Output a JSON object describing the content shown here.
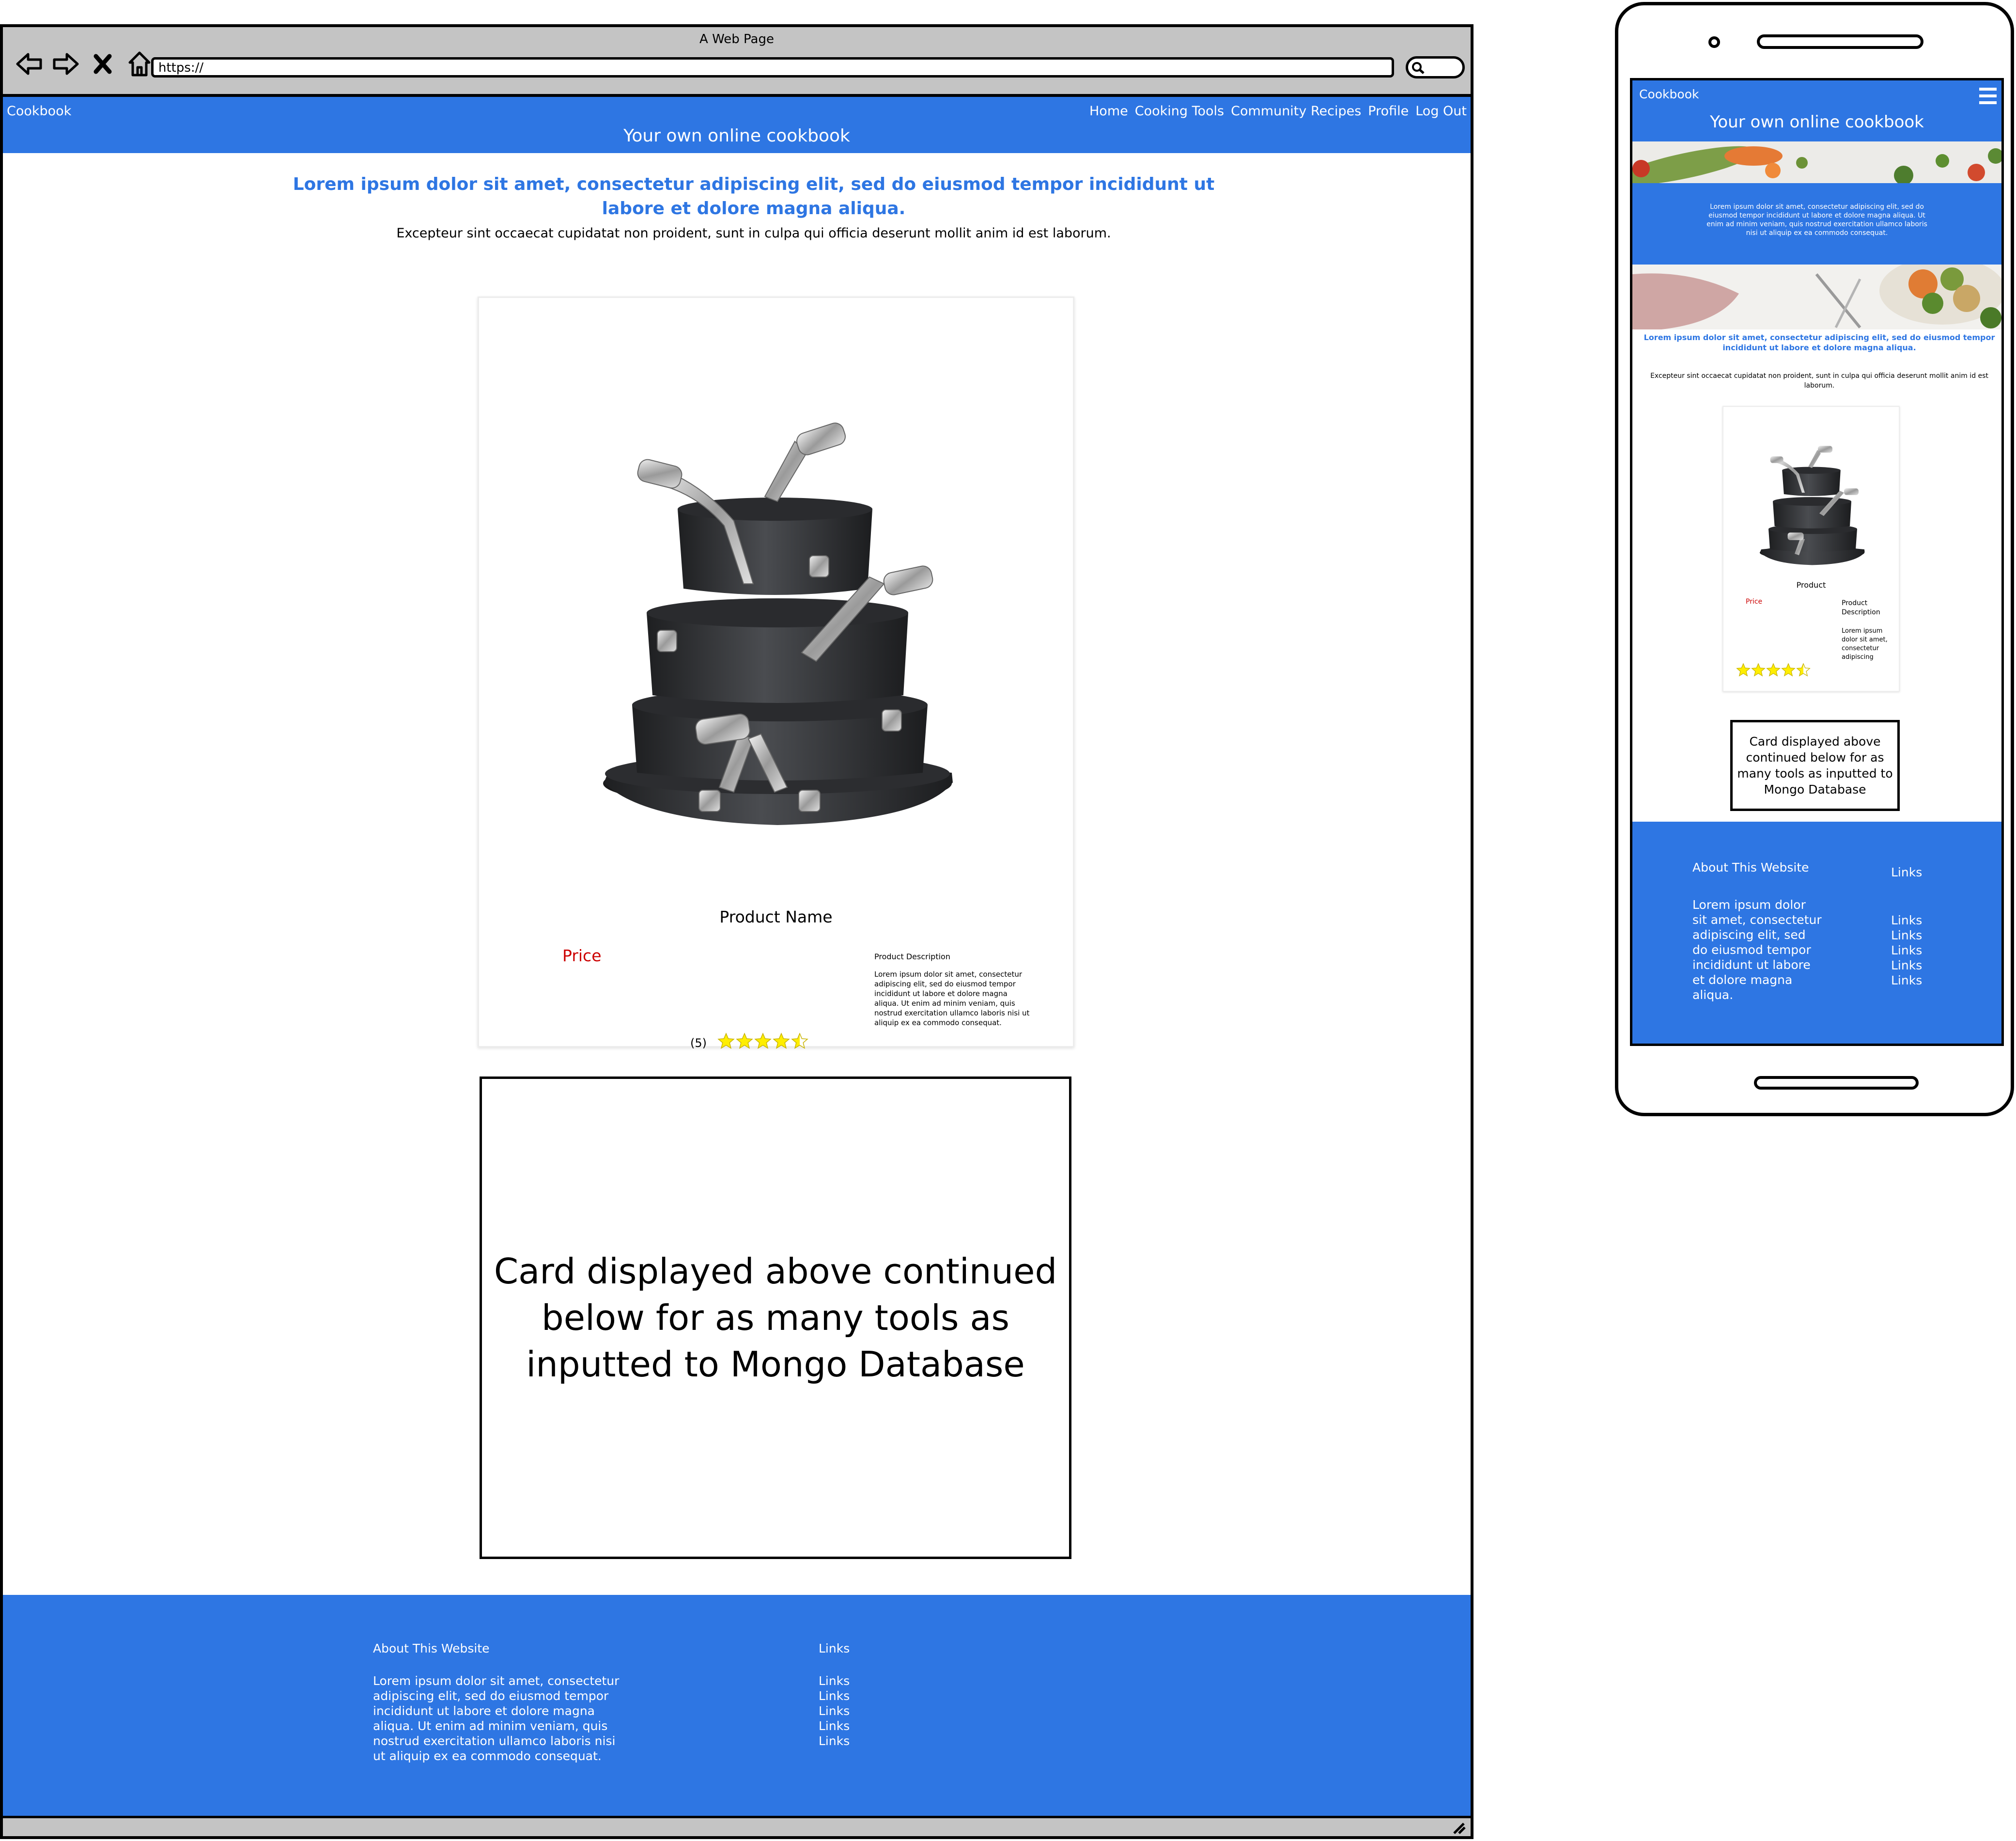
{
  "browser": {
    "window_title": "A Web Page",
    "address": "https://",
    "icons": [
      "back-arrow-icon",
      "forward-arrow-icon",
      "close-x-icon",
      "home-icon",
      "search-icon",
      "resize-grip-icon"
    ]
  },
  "site": {
    "brand": "Cookbook",
    "menu": [
      "Home",
      "Cooking Tools",
      "Community Recipes",
      "Profile",
      "Log Out"
    ],
    "hero_title": "Your own online cookbook",
    "accent_color": "#2e76e3",
    "price_color": "#cc0000",
    "star_color": "#ffee00"
  },
  "intro": {
    "lead": "Lorem ipsum dolor sit amet, consectetur adipiscing elit, sed do eiusmod tempor incididunt ut labore et dolore magna aliqua.",
    "sub": "Excepteur sint occaecat cupidatat non proident, sunt in culpa qui officia deserunt mollit anim id est laborum."
  },
  "card": {
    "image": "stacked-cookware-pots-image",
    "product_name": "Product Name",
    "price": "Price",
    "description_title": "Product Description",
    "description_text": "Lorem ipsum dolor sit amet, consectetur adipiscing elit, sed do eiusmod tempor incididunt ut labore et dolore magna aliqua. Ut enim ad minim veniam, quis nostrud exercitation ullamco laboris nisi ut aliquip ex ea commodo consequat.",
    "rating_count": "(5)",
    "rating": 4.5,
    "rating_max": 5
  },
  "note": {
    "text": "Card displayed above continued below for as many tools as inputted to Mongo Database"
  },
  "footer": {
    "about_heading": "About This Website",
    "about_text": "Lorem ipsum dolor sit amet, consectetur adipiscing elit, sed do eiusmod tempor incididunt ut labore et dolore magna aliqua. Ut enim ad minim veniam, quis nostrud exercitation ullamco laboris nisi ut aliquip ex ea commodo consequat.",
    "links_heading": "Links",
    "links": [
      "Links",
      "Links",
      "Links",
      "Links",
      "Links"
    ]
  },
  "mobile": {
    "brand": "Cookbook",
    "menu_icon": "hamburger-menu-icon",
    "hero_title": "Your own online cookbook",
    "banner_text": "Lorem ipsum dolor sit amet, consectetur adipiscing elit, sed do eiusmod tempor incididunt ut labore et dolore magna aliqua. Ut enim ad minim veniam, quis nostrud exercitation ullamco laboris nisi ut aliquip ex ea commodo consequat.",
    "lead": "Lorem ipsum dolor sit amet, consectetur adipiscing elit, sed do eiusmod tempor incididunt ut labore et dolore magna aliqua.",
    "sub": "Excepteur sint occaecat cupidatat non proident, sunt in culpa qui officia deserunt mollit anim id est laborum.",
    "product_name": "Product",
    "price": "Price",
    "description_title": "Product Description",
    "description_text": "Lorem ipsum dolor sit amet, consectetur adipiscing",
    "rating": 4.5,
    "note": "Card displayed above continued below for as many tools as inputted to Mongo Database",
    "about_heading": "About This Website",
    "about_text": "Lorem ipsum dolor sit amet, consectetur adipiscing elit, sed do eiusmod tempor incididunt ut labore et dolore magna aliqua.",
    "links_heading": "Links",
    "links": [
      "Links",
      "Links",
      "Links",
      "Links",
      "Links"
    ]
  }
}
